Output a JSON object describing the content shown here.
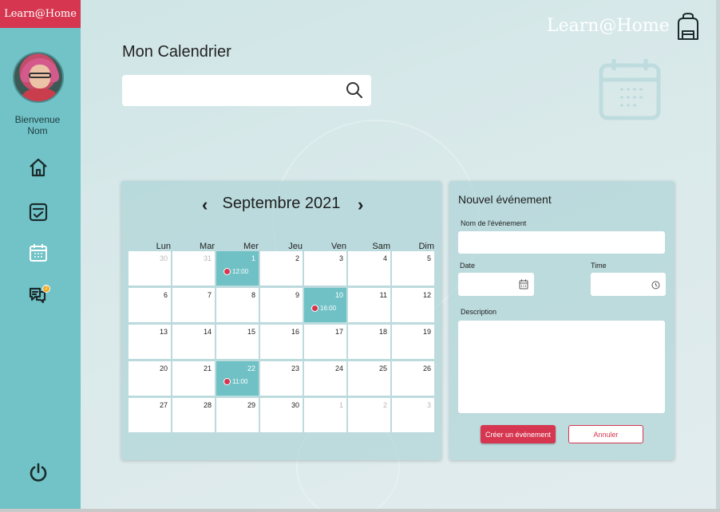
{
  "sidebar": {
    "brand": "Learn@Home",
    "welcome_line1": "Bienvenue",
    "welcome_line2": "Nom",
    "notification_count": "2",
    "items": [
      {
        "icon": "home-icon"
      },
      {
        "icon": "tasks-icon"
      },
      {
        "icon": "calendar-icon"
      },
      {
        "icon": "chat-icon"
      },
      {
        "icon": "power-icon"
      }
    ]
  },
  "header": {
    "logo_text": "Learn@Home",
    "page_title": "Mon Calendrier"
  },
  "search": {
    "value": "",
    "placeholder": ""
  },
  "calendar": {
    "month_label": "Septembre 2021",
    "weekdays": [
      "Lun",
      "Mar",
      "Mer",
      "Jeu",
      "Ven",
      "Sam",
      "Dim"
    ],
    "weeks": [
      [
        {
          "d": "30",
          "out": true
        },
        {
          "d": "31",
          "out": true
        },
        {
          "d": "1",
          "event": "12:00"
        },
        {
          "d": "2"
        },
        {
          "d": "3"
        },
        {
          "d": "4"
        },
        {
          "d": "5"
        }
      ],
      [
        {
          "d": "6"
        },
        {
          "d": "7"
        },
        {
          "d": "8"
        },
        {
          "d": "9"
        },
        {
          "d": "10",
          "event": "16:00"
        },
        {
          "d": "11"
        },
        {
          "d": "12"
        }
      ],
      [
        {
          "d": "13"
        },
        {
          "d": "14"
        },
        {
          "d": "15"
        },
        {
          "d": "16"
        },
        {
          "d": "17"
        },
        {
          "d": "18"
        },
        {
          "d": "19"
        }
      ],
      [
        {
          "d": "20"
        },
        {
          "d": "21"
        },
        {
          "d": "22",
          "event": "11:00"
        },
        {
          "d": "23"
        },
        {
          "d": "24"
        },
        {
          "d": "25"
        },
        {
          "d": "26"
        }
      ],
      [
        {
          "d": "27"
        },
        {
          "d": "28"
        },
        {
          "d": "29"
        },
        {
          "d": "30"
        },
        {
          "d": "1",
          "out": true
        },
        {
          "d": "2",
          "out": true
        },
        {
          "d": "3",
          "out": true
        }
      ]
    ]
  },
  "form": {
    "title": "Nouvel événement",
    "name_label": "Nom de l'événement",
    "name_value": "",
    "date_label": "Date",
    "date_value": "",
    "time_label": "Time",
    "time_value": "",
    "description_label": "Description",
    "description_value": "",
    "create_label": "Créer un événement",
    "cancel_label": "Annuler"
  },
  "colors": {
    "accent": "#d6364f",
    "sidebar": "#71c3c7",
    "event_cell": "#6fc1c6"
  }
}
